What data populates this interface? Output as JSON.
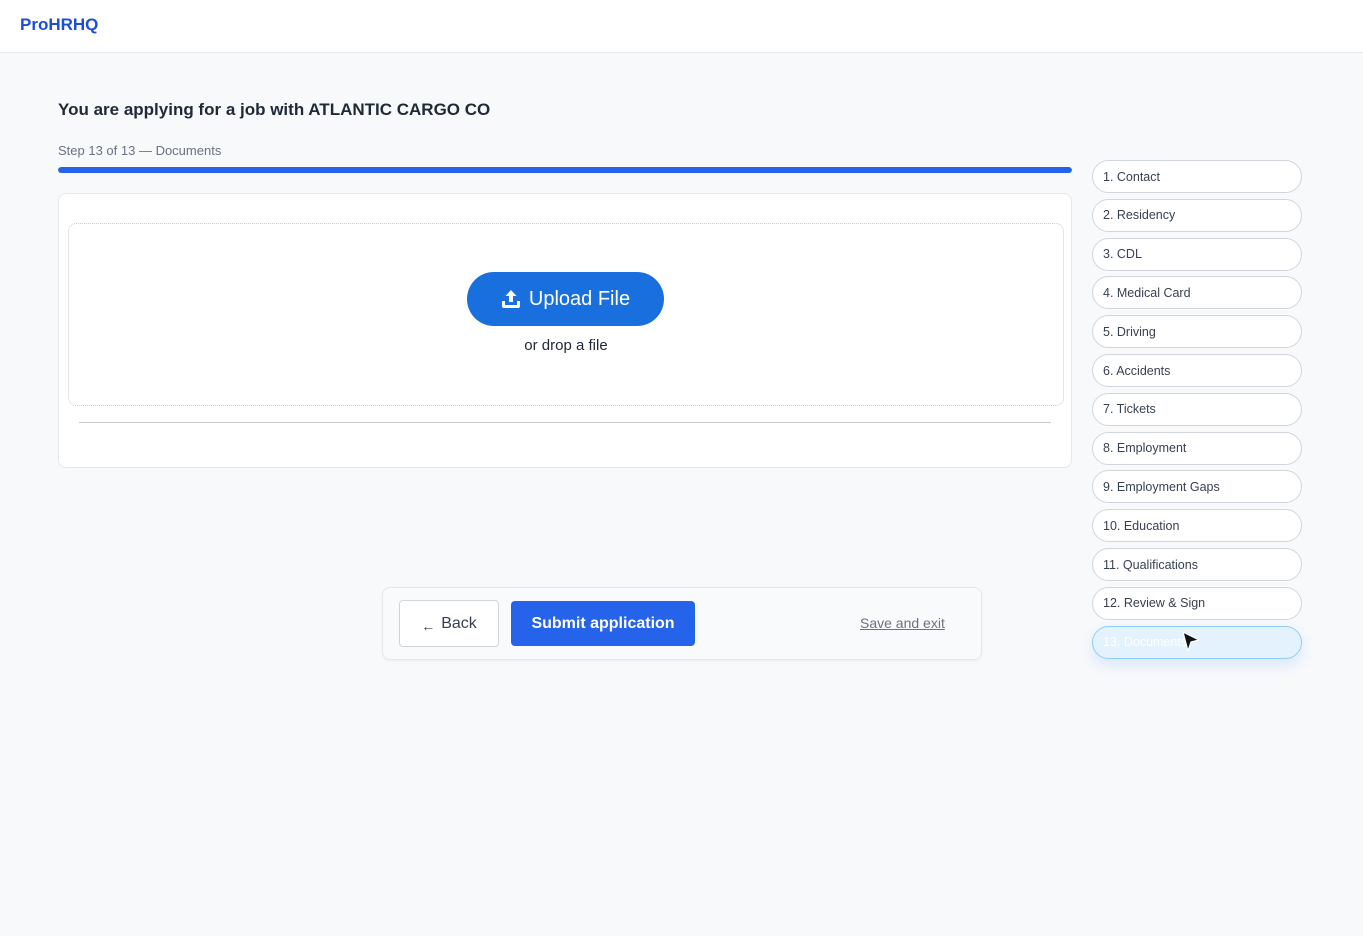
{
  "brand": {
    "name": "ProHRHQ"
  },
  "header": {
    "title": "You are applying for a job with ATLANTIC CARGO CO"
  },
  "progress": {
    "label": "Step 13 of 13 — Documents",
    "fraction": 1.0,
    "color": "#2563eb"
  },
  "upload": {
    "button_label": "Upload File",
    "drop_hint": "or drop a file",
    "icon": "upload-icon"
  },
  "footer": {
    "back_label": "Back",
    "back_icon": "arrow-left-icon",
    "submit_label": "Submit application",
    "save_exit_label": "Save and exit"
  },
  "steps": [
    {
      "label": "1. Contact"
    },
    {
      "label": "2. Residency"
    },
    {
      "label": "3. CDL"
    },
    {
      "label": "4. Medical Card"
    },
    {
      "label": "5. Driving"
    },
    {
      "label": "6. Accidents"
    },
    {
      "label": "7. Tickets"
    },
    {
      "label": "8. Employment"
    },
    {
      "label": "9. Employment Gaps"
    },
    {
      "label": "10. Education"
    },
    {
      "label": "11. Qualifications"
    },
    {
      "label": "12. Review & Sign"
    },
    {
      "label": "13. Documents",
      "active": true
    }
  ],
  "colors": {
    "accent": "#2563eb",
    "upload_button": "#1a6fdf",
    "active_step_bg": "#e3f2fd"
  }
}
